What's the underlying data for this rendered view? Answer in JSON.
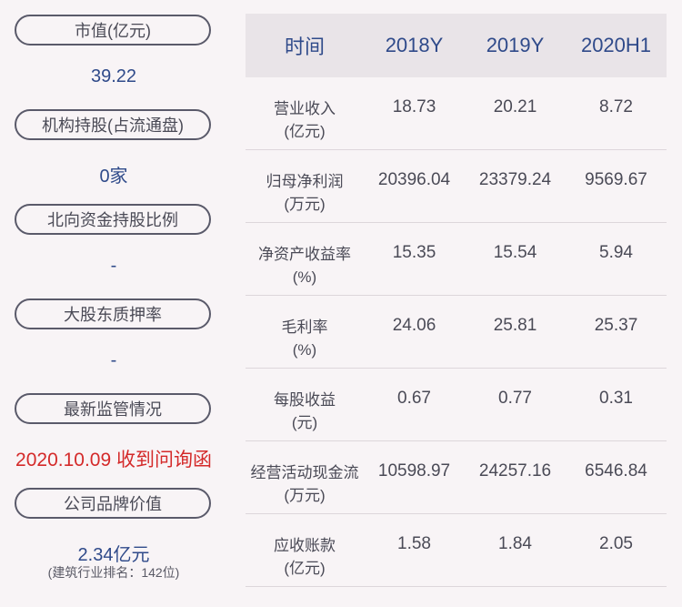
{
  "left": {
    "items": [
      {
        "label": "市值(亿元)",
        "value": "39.22"
      },
      {
        "label": "机构持股(占流通盘)",
        "value": "0家"
      },
      {
        "label": "北向资金持股比例",
        "value": "-"
      },
      {
        "label": "大股东质押率",
        "value": "-"
      },
      {
        "label": "最新监管情况",
        "value": "2020.10.09 收到问询函"
      },
      {
        "label": "公司品牌价值",
        "value": "2.34亿元",
        "sub": "(建筑行业排名：142位)"
      }
    ]
  },
  "table": {
    "headers": [
      "时间",
      "2018Y",
      "2019Y",
      "2020H1"
    ],
    "rows": [
      {
        "label1": "营业收入",
        "label2": "(亿元)",
        "v": [
          "18.73",
          "20.21",
          "8.72"
        ]
      },
      {
        "label1": "归母净利润",
        "label2": "(万元)",
        "v": [
          "20396.04",
          "23379.24",
          "9569.67"
        ]
      },
      {
        "label1": "净资产收益率",
        "label2": "(%)",
        "v": [
          "15.35",
          "15.54",
          "5.94"
        ]
      },
      {
        "label1": "毛利率",
        "label2": "(%)",
        "v": [
          "24.06",
          "25.81",
          "25.37"
        ]
      },
      {
        "label1": "每股收益",
        "label2": "(元)",
        "v": [
          "0.67",
          "0.77",
          "0.31"
        ]
      },
      {
        "label1": "经营活动现金流",
        "label2": "(万元)",
        "v": [
          "10598.97",
          "24257.16",
          "6546.84"
        ]
      },
      {
        "label1": "应收账款",
        "label2": "(亿元)",
        "v": [
          "1.58",
          "1.84",
          "2.05"
        ]
      }
    ]
  },
  "colors": {
    "value_blue": "#2f4a8a",
    "alert_red": "#d42a2a",
    "header_bg": "#e9e4e8"
  }
}
